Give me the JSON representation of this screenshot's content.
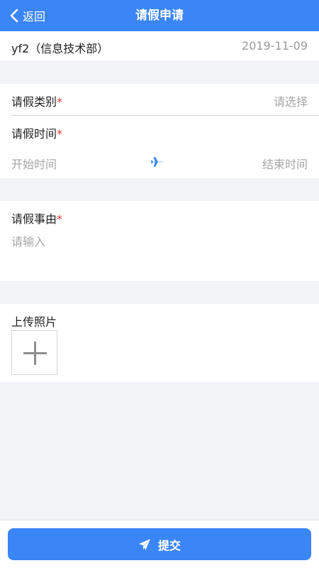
{
  "header": {
    "back_label": "返回",
    "title": "请假申请"
  },
  "user": {
    "name": "yf2（信息技术部）",
    "date": "2019-11-09"
  },
  "form": {
    "type_label": "请假类别",
    "type_placeholder": "请选择",
    "time_label": "请假时间",
    "start_placeholder": "开始时间",
    "end_placeholder": "结束时间",
    "reason_label": "请假事由",
    "reason_placeholder": "请输入",
    "upload_label": "上传照片",
    "required_mark": "*"
  },
  "actions": {
    "submit_label": "提交"
  },
  "colors": {
    "accent": "#3b86f7",
    "required": "#e53935",
    "placeholder": "#a6a6a6",
    "background": "#f2f3f7"
  }
}
